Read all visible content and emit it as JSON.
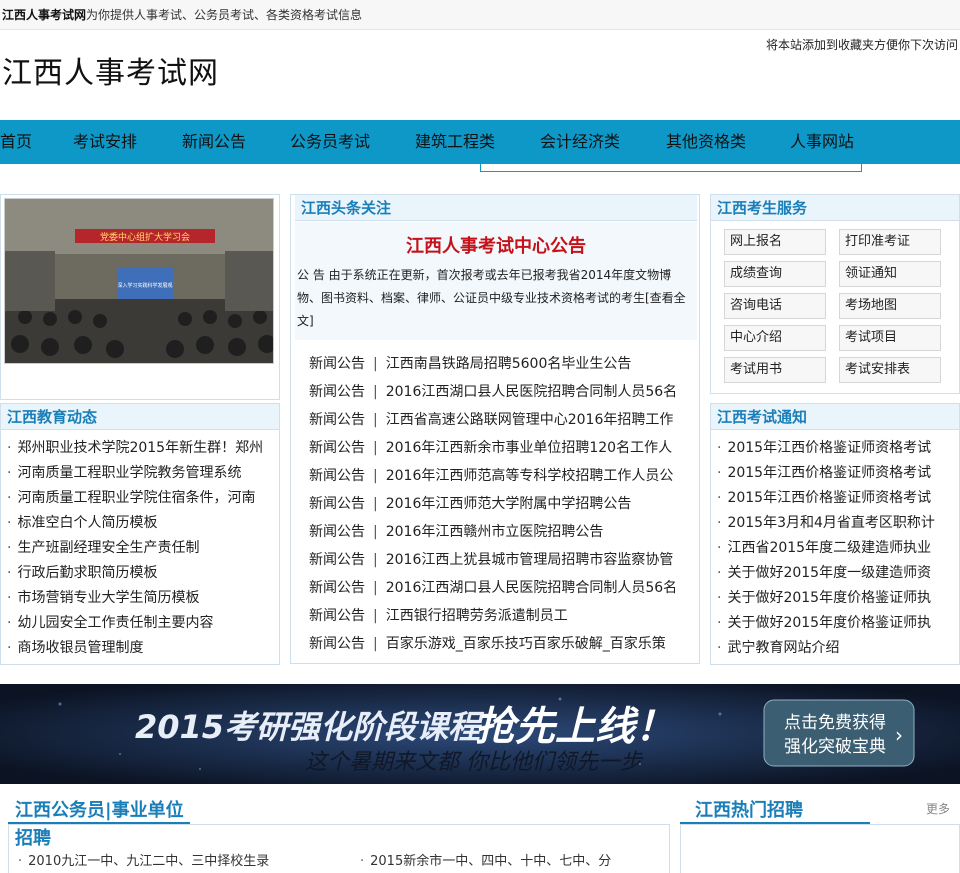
{
  "topbar": {
    "site_name": "江西人事考试网",
    "tagline": "为你提供人事考试、公务员考试、各类资格考试信息"
  },
  "header": {
    "logo_text": "江西人事考试网",
    "favorite_text": "将本站添加到收藏夹方便你下次访问"
  },
  "nav": {
    "items": [
      "首页",
      "考试安排",
      "新闻公告",
      "公务员考试",
      "建筑工程类",
      "会计经济类",
      "其他资格类",
      "人事网站"
    ]
  },
  "headline": {
    "section_title": "江西头条关注",
    "title": "江西人事考试中心公告",
    "body": "公 告 由于系统正在更新，首次报考或去年已报考我省2014年度文物博物、图书资料、档案、律师、公证员中级专业技术资格考试的考生[查看全文]",
    "news": [
      {
        "tag": "新闻公告",
        "text": "江西南昌铁路局招聘5600名毕业生公告"
      },
      {
        "tag": "新闻公告",
        "text": "2016江西湖口县人民医院招聘合同制人员56名"
      },
      {
        "tag": "新闻公告",
        "text": "江西省高速公路联网管理中心2016年招聘工作"
      },
      {
        "tag": "新闻公告",
        "text": "2016年江西新余市事业单位招聘120名工作人"
      },
      {
        "tag": "新闻公告",
        "text": "2016年江西师范高等专科学校招聘工作人员公"
      },
      {
        "tag": "新闻公告",
        "text": "2016年江西师范大学附属中学招聘公告"
      },
      {
        "tag": "新闻公告",
        "text": "2016年江西赣州市立医院招聘公告"
      },
      {
        "tag": "新闻公告",
        "text": "2016江西上犹县城市管理局招聘市容监察协管"
      },
      {
        "tag": "新闻公告",
        "text": "2016江西湖口县人民医院招聘合同制人员56名"
      },
      {
        "tag": "新闻公告",
        "text": "江西银行招聘劳务派遣制员工"
      },
      {
        "tag": "新闻公告",
        "text": "百家乐游戏_百家乐技巧百家乐破解_百家乐策"
      }
    ]
  },
  "edu": {
    "title": "江西教育动态",
    "items": [
      "郑州职业技术学院2015年新生群！郑州",
      "河南质量工程职业学院教务管理系统",
      "河南质量工程职业学院住宿条件，河南",
      "标准空白个人简历模板",
      "生产班副经理安全生产责任制",
      "行政后勤求职简历模板",
      "市场营销专业大学生简历模板",
      "幼儿园安全工作责任制主要内容",
      "商场收银员管理制度"
    ]
  },
  "service": {
    "title": "江西考生服务",
    "buttons": [
      "网上报名",
      "打印准考证",
      "成绩查询",
      "领证通知",
      "咨询电话",
      "考场地图",
      "中心介绍",
      "考试项目",
      "考试用书",
      "考试安排表"
    ]
  },
  "notice": {
    "title": "江西考试通知",
    "items": [
      "2015年江西价格鉴证师资格考试",
      "2015年江西价格鉴证师资格考试",
      "2015年江西价格鉴证师资格考试",
      "2015年3月和4月省直考区职称计",
      "江西省2015年度二级建造师执业",
      "关于做好2015年度一级建造师资",
      "关于做好2015年度价格鉴证师执",
      "关于做好2015年度价格鉴证师执",
      "武宁教育网站介绍"
    ]
  },
  "banner": {
    "headline_part1": "2015考研强化阶段课程",
    "headline_part2": "抢先上线！",
    "subline": "这个暑期来文都 你比他们领先一步",
    "cta_line1": "点击免费获得",
    "cta_line2": "强化突破宝典"
  },
  "bottom": {
    "left_title": "江西公务员|事业单位",
    "left_title2": "招聘",
    "left_items": [
      "2010九江一中、九江二中、三中择校生录",
      "2015新余市一中、四中、十中、七中、分"
    ],
    "right_title": "江西热门招聘",
    "more": "更多"
  },
  "photo": {
    "banner_text": "党委中心组扩大学习会",
    "screen_text": "深入学习实践科学发展观"
  },
  "colors": {
    "nav": "#0e98c8",
    "title_blue": "#1a7fb8",
    "headline_red": "#c4121a"
  }
}
